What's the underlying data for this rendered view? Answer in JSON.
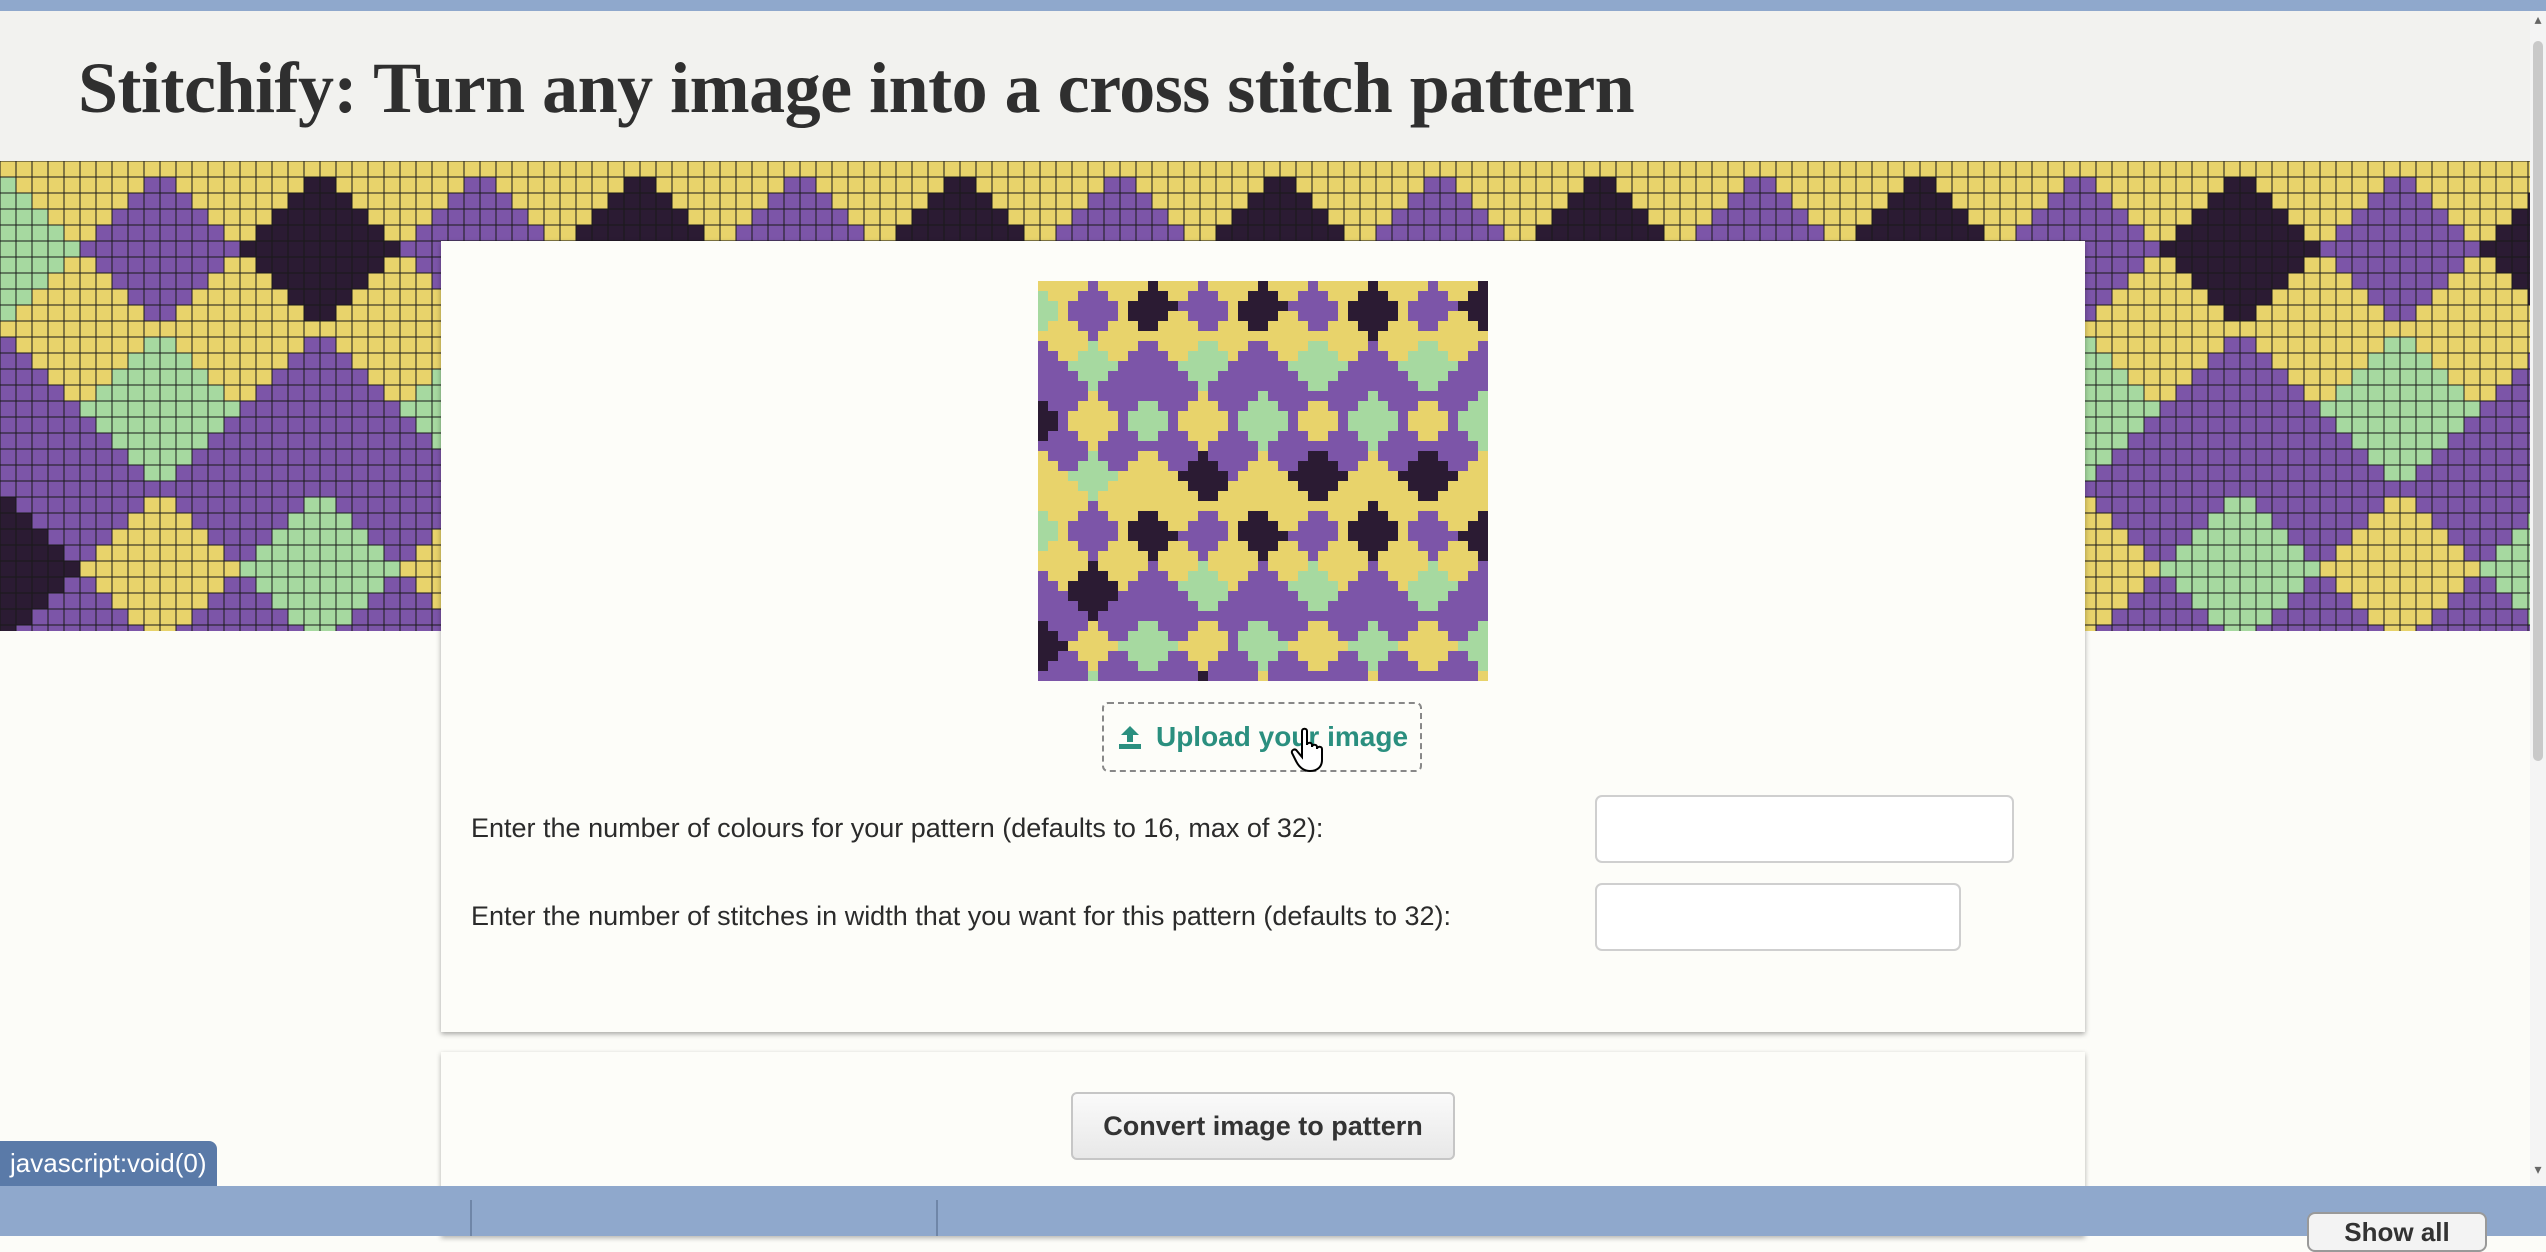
{
  "page": {
    "title": "Stitchify: Turn any image into a cross stitch pattern"
  },
  "upload": {
    "label": "Upload your image"
  },
  "form": {
    "colours_label": "Enter the number of colours for your pattern (defaults to 16, max of 32):",
    "colours_value": "",
    "width_label": "Enter the number of stitches in width that you want for this pattern (defaults to 32):",
    "width_value": ""
  },
  "actions": {
    "convert_label": "Convert image to pattern"
  },
  "status": {
    "url": "javascript:void(0)"
  },
  "downloads": {
    "show_all_label": "Show all"
  },
  "colors": {
    "accent": "#2a8f7f",
    "banner_palette": [
      "#e8d36b",
      "#d8394f",
      "#a6d9a0",
      "#3f8a3a",
      "#7c55a8",
      "#e98fb4",
      "#2b1b33",
      "#cfcfd9"
    ]
  },
  "icons": [
    "upload-icon",
    "hand-cursor-icon"
  ]
}
